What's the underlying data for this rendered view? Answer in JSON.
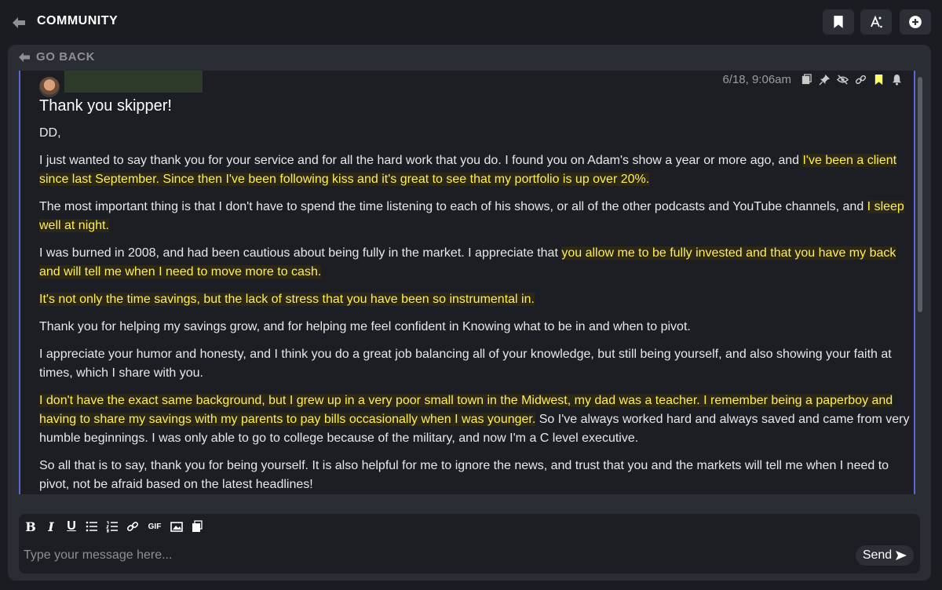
{
  "header": {
    "title": "COMMUNITY",
    "icons": [
      "back-arrow-icon",
      "bookmark-icon",
      "text-style-icon",
      "plus-icon"
    ]
  },
  "nav": {
    "go_back_label": "GO BACK"
  },
  "message": {
    "timestamp": "6/18, 9:06am",
    "title": "Thank you skipper!",
    "paragraphs": [
      {
        "segments": [
          {
            "text": "DD,",
            "highlight": false
          }
        ]
      },
      {
        "segments": [
          {
            "text": "I just wanted to say thank you for your service and for all the hard work that you do. I found you on Adam's show a year or more ago, and ",
            "highlight": false
          },
          {
            "text": "I've been a client since last September. Since then I've been following kiss and it's great to see that my portfolio is up over 20%.",
            "highlight": true
          }
        ]
      },
      {
        "segments": [
          {
            "text": "The most important thing is that I don't have to spend the time listening to each of his shows, or all of the other podcasts and YouTube channels, and ",
            "highlight": false
          },
          {
            "text": "I sleep well at night.",
            "highlight": true
          }
        ]
      },
      {
        "segments": [
          {
            "text": "I was burned in 2008, and had been cautious about being fully in the market. I appreciate that ",
            "highlight": false
          },
          {
            "text": "you allow me to be fully invested and that you have my back and will tell me when I need to move more to cash.",
            "highlight": true
          }
        ]
      },
      {
        "segments": [
          {
            "text": "It's not only the time savings, but the lack of stress that you have been so instrumental in.",
            "highlight": true
          }
        ]
      },
      {
        "segments": [
          {
            "text": "Thank you for helping my savings grow, and for helping me feel confident in Knowing what to be in and when to pivot.",
            "highlight": false
          }
        ]
      },
      {
        "segments": [
          {
            "text": "I appreciate your humor and honesty, and I think you do a great job balancing all of your knowledge, but still being yourself, and also showing your faith at times, which I share with you.",
            "highlight": false
          }
        ]
      },
      {
        "segments": [
          {
            "text": "I don't have the exact same background, but I grew up in a very poor small town in the Midwest, my dad was a teacher. I remember being a paperboy and having to share my savings with my parents to pay bills occasionally when I was younger.",
            "highlight": true
          },
          {
            "text": " So I've always worked hard and always saved and came from very humble beginnings. I was only able to go to college because of the military, and now I'm a C level executive.",
            "highlight": false
          }
        ]
      },
      {
        "segments": [
          {
            "text": "So all that is to say, thank you for being yourself. It is also helpful for me to ignore the news, and trust that you and the markets will tell me when I need to pivot, not be afraid based on the latest headlines!",
            "highlight": false
          }
        ]
      }
    ]
  },
  "composer": {
    "toolbar": {
      "bold": "B",
      "italic": "I",
      "underline": "U",
      "gif": "GIF"
    },
    "placeholder": "Type your message here...",
    "send_label": "Send"
  },
  "colors": {
    "background": "#1a1c21",
    "panel": "#2a2d33",
    "highlight_text": "#ffee58",
    "accent_border": "#5a67d8"
  }
}
